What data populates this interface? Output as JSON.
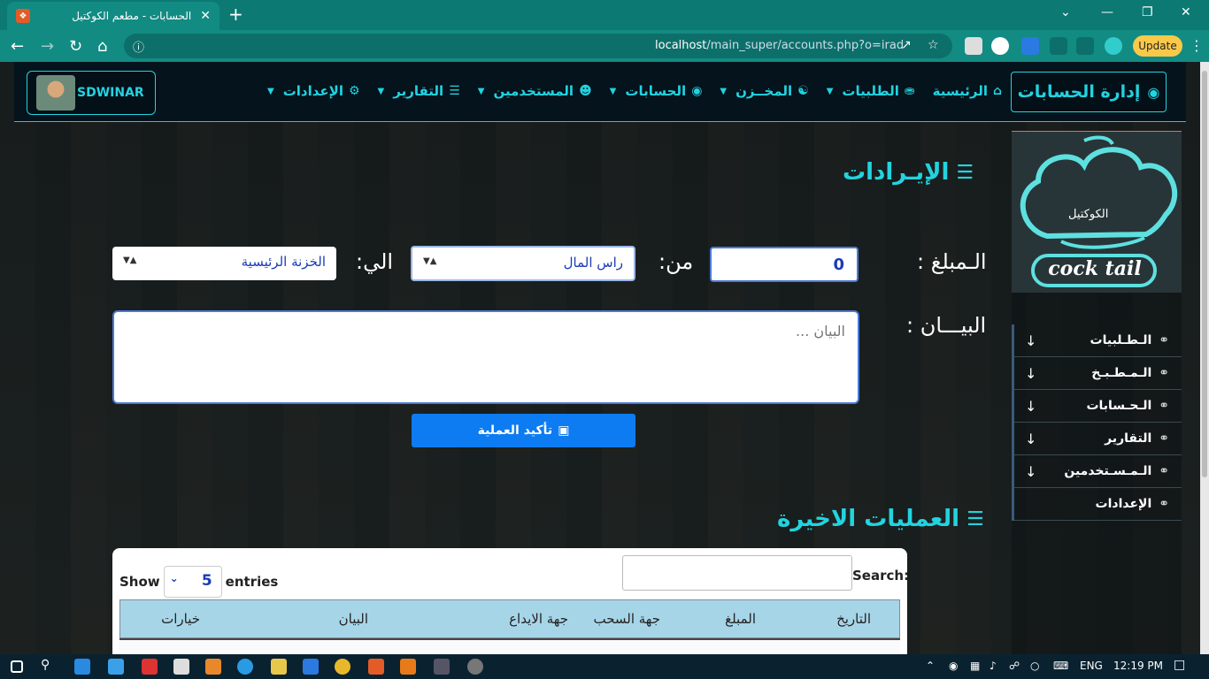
{
  "browser": {
    "tab_title": "الحسابات - مطعم الكوكتيل",
    "url_host": "localhost",
    "url_path": "/main_super/accounts.php?o=irad",
    "update_label": "Update"
  },
  "nav": {
    "brand_name": "SDWINAR",
    "manager_title": "إدارة الحسابات",
    "items": [
      {
        "label": "الرئيسية",
        "icon": "home-icon"
      },
      {
        "label": "الطلبيات",
        "icon": "cart-icon"
      },
      {
        "label": "المخــزن",
        "icon": "database-icon"
      },
      {
        "label": "الحسابات",
        "icon": "money-icon"
      },
      {
        "label": "المستخدمين",
        "icon": "users-icon"
      },
      {
        "label": "التقارير",
        "icon": "report-icon"
      },
      {
        "label": "الإعدادات",
        "icon": "gear-icon"
      }
    ]
  },
  "sidebar": {
    "logo_text": "cock tail",
    "logo_arabic": "الكوكتيل",
    "items": [
      {
        "label": "الـطـلبيات"
      },
      {
        "label": "الـمـطـبـخ"
      },
      {
        "label": "الـحـسابات"
      },
      {
        "label": "التقارير"
      },
      {
        "label": "الـمـسـتخدمين"
      },
      {
        "label": "الإعدادات"
      }
    ]
  },
  "form": {
    "section_title": "الإيـرادات",
    "amount_label": "الـمبلغ :",
    "amount_value": "0",
    "from_label": "من:",
    "from_value": "راس المال",
    "to_label": "الي:",
    "to_value": "الخزنة الرئيسية",
    "desc_label": "البيـــان :",
    "desc_placeholder": "البيان ...",
    "confirm_label": "تأكيد العملية"
  },
  "recent": {
    "section_title": "العمليات الاخيرة",
    "show_label": "Show",
    "entries_value": "5",
    "entries_label": "entries",
    "search_label": "Search:",
    "columns": [
      "التاريخ",
      "المبلغ",
      "جهة السحب",
      "جهة الايداع",
      "البيان",
      "خيارات"
    ]
  },
  "taskbar": {
    "lang": "ENG",
    "time": "12:19 PM"
  }
}
